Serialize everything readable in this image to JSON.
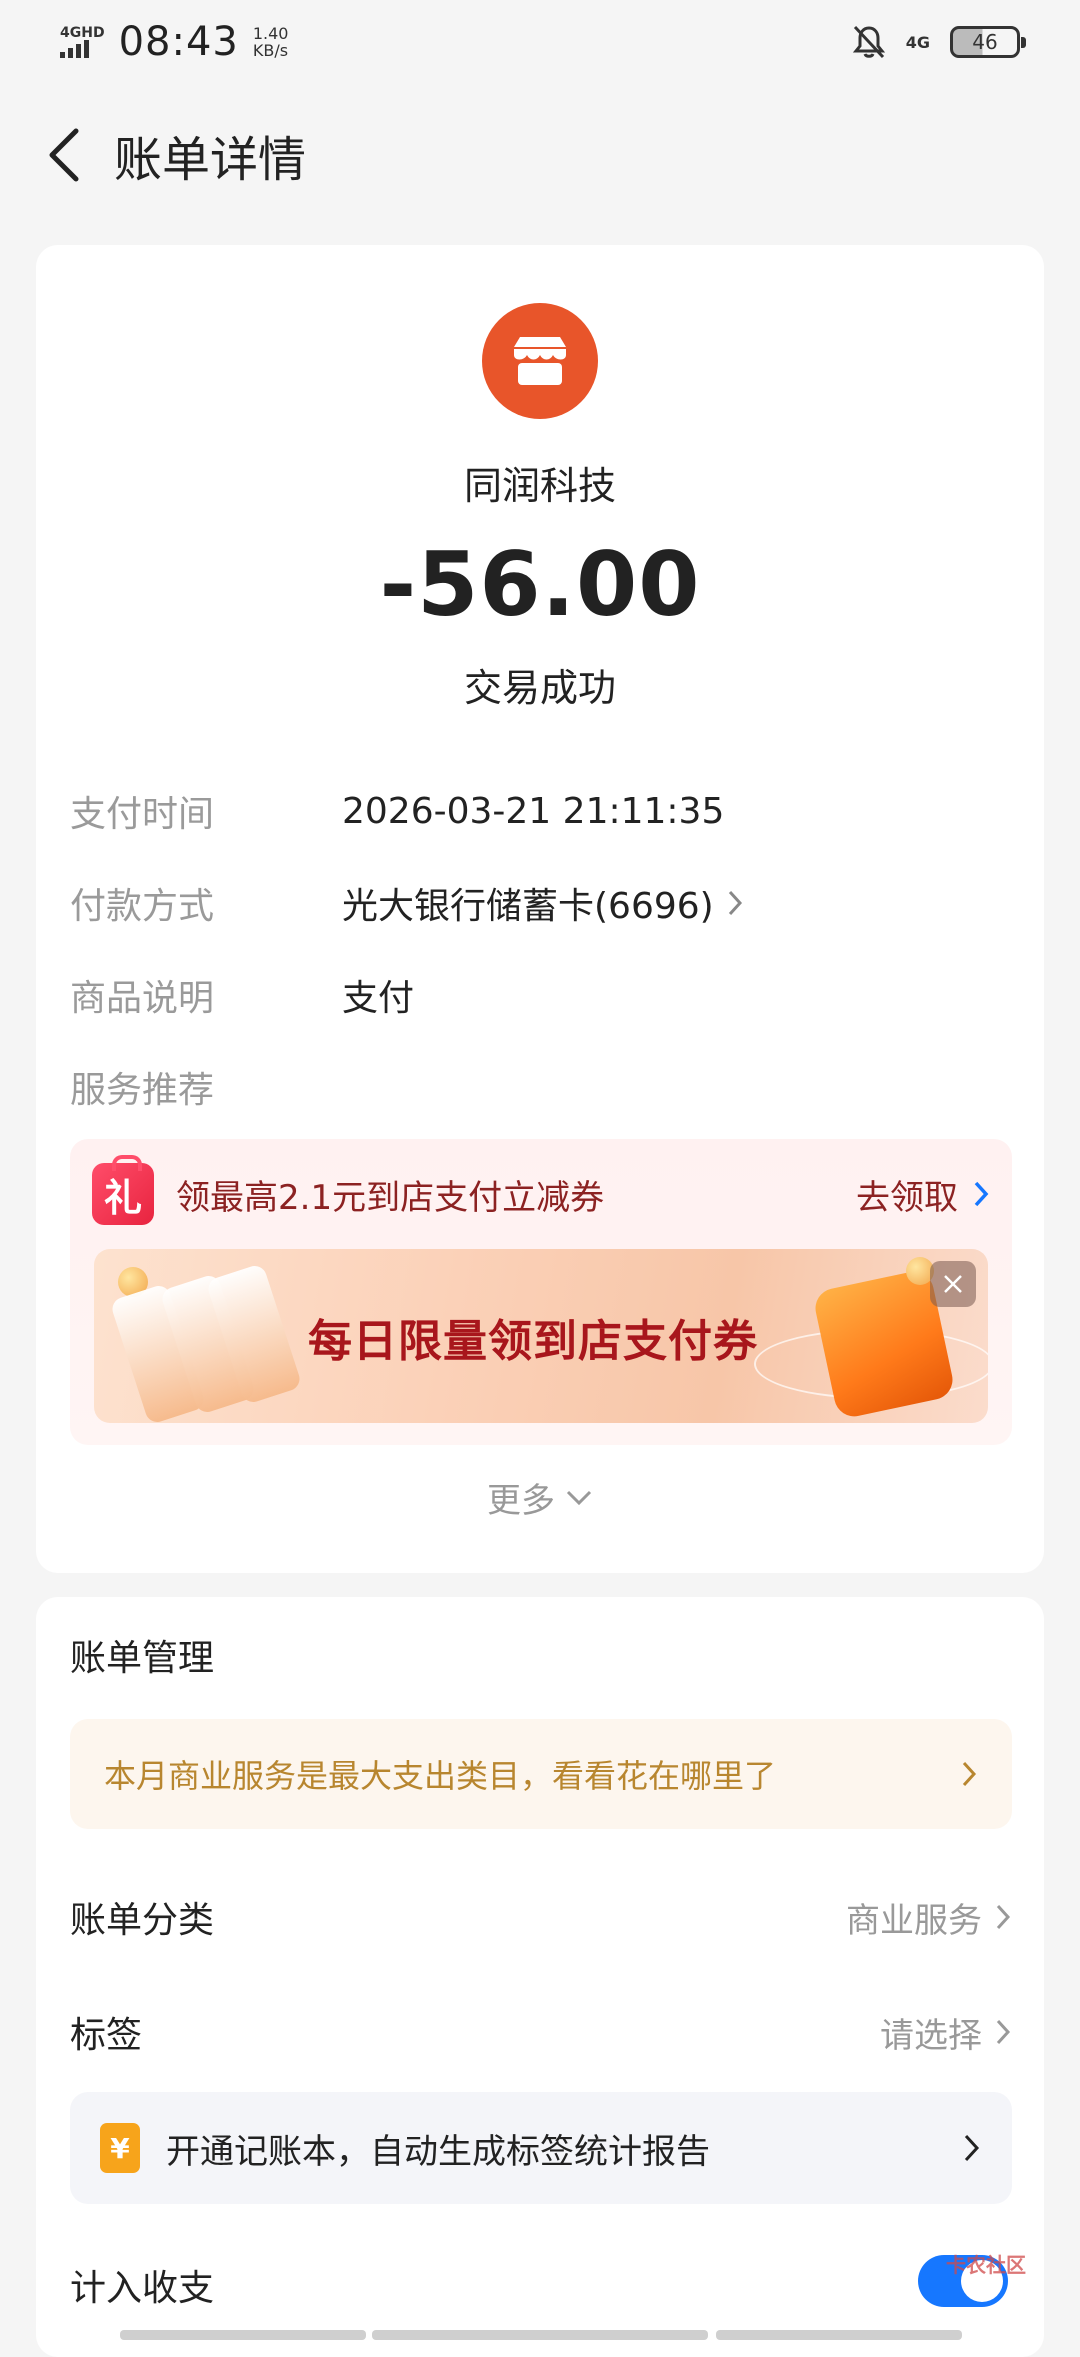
{
  "status_bar": {
    "network_type": "4GHD",
    "time": "08:43",
    "speed_value": "1.40",
    "speed_unit": "KB/s",
    "mobile_data": "4G",
    "battery_level": "46",
    "icons": [
      "signal-icon",
      "mute-bell-icon",
      "battery-icon"
    ]
  },
  "navbar": {
    "title": "账单详情",
    "back_icon": "chevron-left-icon"
  },
  "transaction": {
    "merchant_name": "同润科技",
    "merchant_icon": "storefront-icon",
    "merchant_icon_color": "#e8552a",
    "amount": "-56.00",
    "status": "交易成功"
  },
  "details": [
    {
      "label": "支付时间",
      "value": "2026-03-21 21:11:35",
      "has_arrow": false
    },
    {
      "label": "付款方式",
      "value": "光大银行储蓄卡(6696)",
      "has_arrow": true
    },
    {
      "label": "商品说明",
      "value": "支付",
      "has_arrow": false
    },
    {
      "label": "服务推荐",
      "value": "",
      "has_arrow": false
    }
  ],
  "promo": {
    "icon_text": "礼",
    "text": "领最高2.1元到店支付立减券",
    "action": "去领取",
    "banner_text": "每日限量领到店支付券",
    "colors": {
      "text": "#8c2222",
      "banner_text": "#a8161c"
    }
  },
  "more_label": "更多",
  "bill_management": {
    "title": "账单管理",
    "insight": "本月商业服务是最大支出类目，看看花在哪里了",
    "category_label": "账单分类",
    "category_value": "商业服务",
    "tag_label": "标签",
    "tag_value": "请选择",
    "ledger_icon_text": "¥",
    "ledger_text": "开通记账本，自动生成标签统计报告",
    "include_label": "计入收支",
    "include_enabled": true,
    "accent_color": "#1677ff"
  },
  "watermark": "卡农社区"
}
